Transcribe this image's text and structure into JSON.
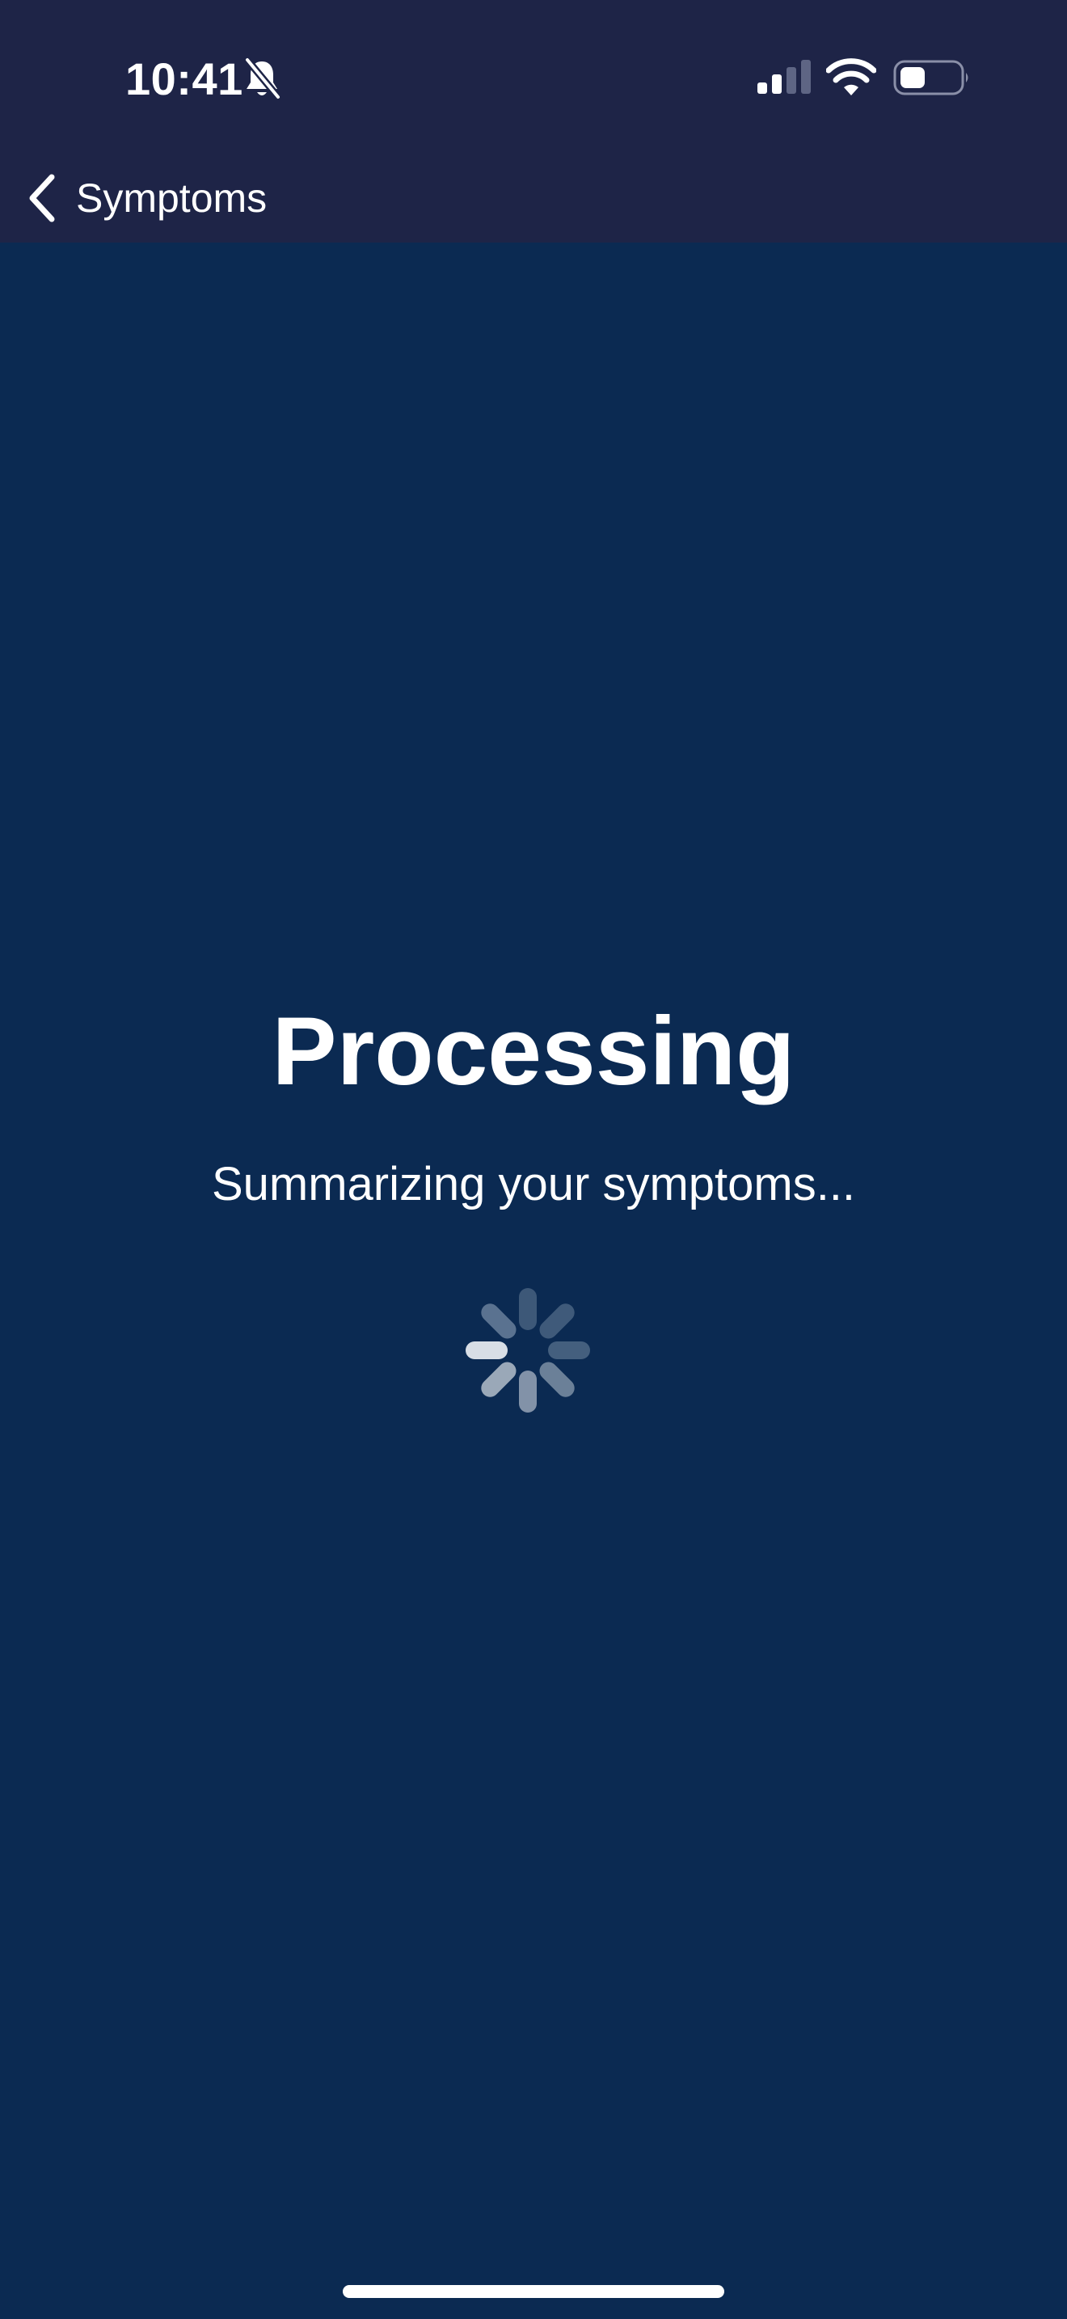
{
  "status_bar": {
    "time": "10:41",
    "silent_icon": "bell-slash-icon",
    "signal_icon": "cellular-signal-icon",
    "wifi_icon": "wifi-icon",
    "battery_icon": "battery-icon",
    "battery_level": 0.4
  },
  "nav": {
    "back_label": "Symptoms",
    "back_icon": "chevron-left-icon"
  },
  "main": {
    "title": "Processing",
    "subtitle": "Summarizing your symptoms...",
    "spinner_icon": "activity-spinner-icon"
  },
  "colors": {
    "header_background": "#1e2447",
    "page_background": "#0b2a52",
    "text": "#ffffff"
  }
}
